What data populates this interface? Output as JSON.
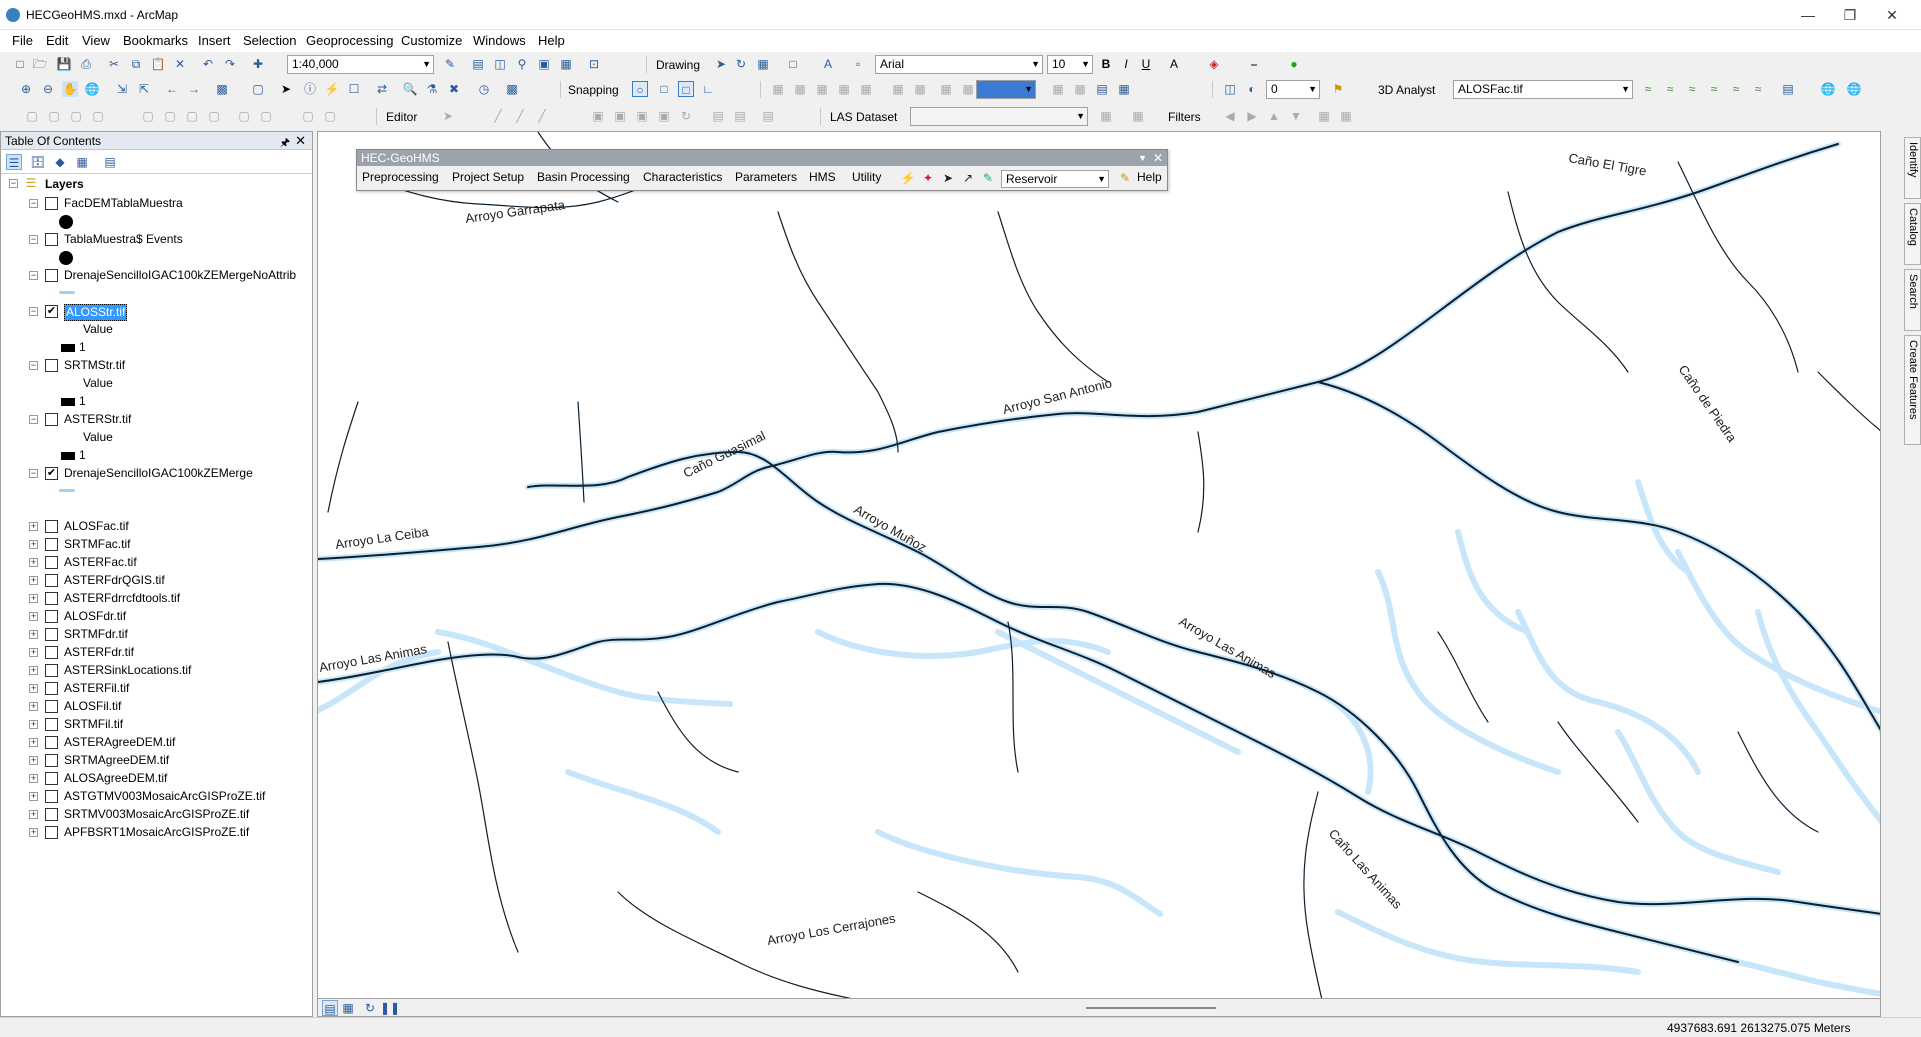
{
  "window": {
    "title": "HECGeoHMS.mxd - ArcMap"
  },
  "menu": [
    "File",
    "Edit",
    "View",
    "Bookmarks",
    "Insert",
    "Selection",
    "Geoprocessing",
    "Customize",
    "Windows",
    "Help"
  ],
  "toolbar": {
    "scale": "1:40,000",
    "drawing_label": "Drawing",
    "font_name": "Arial",
    "font_size": "10",
    "snapping_label": "Snapping",
    "analyst_label": "3D Analyst",
    "analyst_layer": "ALOSFac.tif",
    "editor_label": "Editor",
    "las_label": "LAS Dataset",
    "filters_label": "Filters",
    "level_value": "0"
  },
  "toc": {
    "title": "Table Of Contents",
    "root": "Layers",
    "layers": [
      {
        "name": "FacDEMTablaMuestra",
        "checked": false,
        "expanded": true,
        "symbol": "dot"
      },
      {
        "name": "TablaMuestra$ Events",
        "checked": false,
        "expanded": true,
        "symbol": "dot"
      },
      {
        "name": "DrenajeSencilloIGAC100kZEMergeNoAttrib",
        "checked": false,
        "expanded": true,
        "symbol": "line"
      },
      {
        "name": "ALOSStr.tif",
        "checked": true,
        "expanded": true,
        "selected": true,
        "symbol": "raster",
        "field": "Value",
        "class": "1"
      },
      {
        "name": "SRTMStr.tif",
        "checked": false,
        "expanded": true,
        "symbol": "raster",
        "field": "Value",
        "class": "1"
      },
      {
        "name": "ASTERStr.tif",
        "checked": false,
        "expanded": true,
        "symbol": "raster",
        "field": "Value",
        "class": "1"
      },
      {
        "name": "DrenajeSencilloIGAC100kZEMerge",
        "checked": true,
        "expanded": true,
        "symbol": "line"
      },
      {
        "name": "ALOSFac.tif",
        "checked": false,
        "expanded": false
      },
      {
        "name": "SRTMFac.tif",
        "checked": false,
        "expanded": false
      },
      {
        "name": "ASTERFac.tif",
        "checked": false,
        "expanded": false
      },
      {
        "name": "ASTERFdrQGIS.tif",
        "checked": false,
        "expanded": false
      },
      {
        "name": "ASTERFdrrcfdtools.tif",
        "checked": false,
        "expanded": false
      },
      {
        "name": "ALOSFdr.tif",
        "checked": false,
        "expanded": false
      },
      {
        "name": "SRTMFdr.tif",
        "checked": false,
        "expanded": false
      },
      {
        "name": "ASTERFdr.tif",
        "checked": false,
        "expanded": false
      },
      {
        "name": "ASTERSinkLocations.tif",
        "checked": false,
        "expanded": false
      },
      {
        "name": "ASTERFil.tif",
        "checked": false,
        "expanded": false
      },
      {
        "name": "ALOSFil.tif",
        "checked": false,
        "expanded": false
      },
      {
        "name": "SRTMFil.tif",
        "checked": false,
        "expanded": false
      },
      {
        "name": "ASTERAgreeDEM.tif",
        "checked": false,
        "expanded": false
      },
      {
        "name": "SRTMAgreeDEM.tif",
        "checked": false,
        "expanded": false
      },
      {
        "name": "ALOSAgreeDEM.tif",
        "checked": false,
        "expanded": false
      },
      {
        "name": "ASTGTMV003MosaicArcGISProZE.tif",
        "checked": false,
        "expanded": false
      },
      {
        "name": "SRTMV003MosaicArcGISProZE.tif",
        "checked": false,
        "expanded": false
      },
      {
        "name": "APFBSRT1MosaicArcGISProZE.tif",
        "checked": false,
        "expanded": false
      }
    ]
  },
  "hec": {
    "title": "HEC-GeoHMS",
    "menus": [
      "Preprocessing",
      "Project Setup",
      "Basin Processing",
      "Characteristics",
      "Parameters",
      "HMS",
      "Utility"
    ],
    "combo_value": "Reservoir",
    "help_label": "Help"
  },
  "map_labels": {
    "garrapata": "Arroyo Garrapata",
    "tigre": "Caño El Tigre",
    "san_antonio": "Arroyo San Antonio",
    "guasimal": "Caño Guasimal",
    "piedra": "Caño de Piedra",
    "ceiba": "Arroyo La Ceiba",
    "munoz": "Arroyo Muñoz",
    "animas_n": "Arroyo Las Animas",
    "animas_w": "Arroyo Las Animas",
    "cano_animas": "Caño Las Animas",
    "cerrajones": "Arroyo Los Cerrajones"
  },
  "dock_tabs": [
    "Identify",
    "Catalog",
    "Search",
    "Create Features"
  ],
  "status": {
    "coordinates": "4937683.691  2613275.075 Meters"
  },
  "colors": {
    "river_dark": "#0d1f2e",
    "river_light": "#c8e6fa",
    "selection": "#3399ff"
  }
}
